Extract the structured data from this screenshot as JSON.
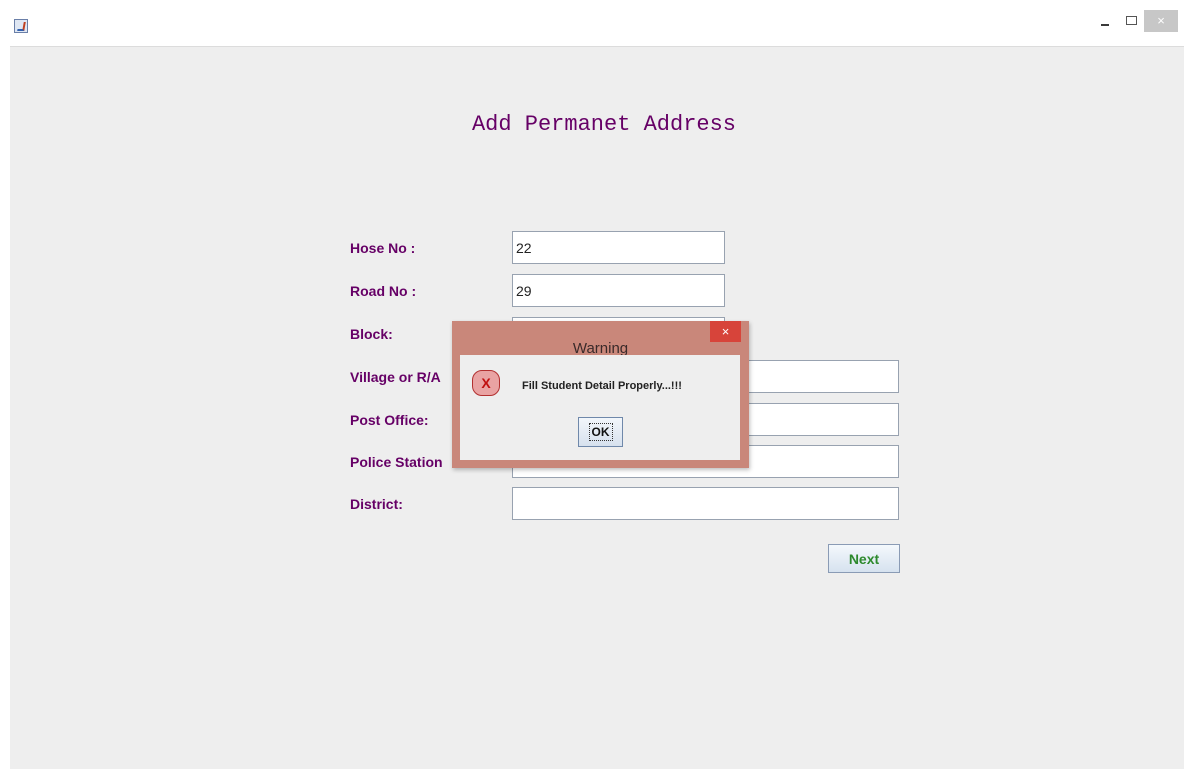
{
  "window": {
    "title": "",
    "app_icon": "java-cup-icon",
    "close_glyph": "×",
    "colors": {
      "background": "#eeeeee",
      "accent": "#660066",
      "next_text": "#2d8a2d"
    }
  },
  "form": {
    "heading": "Add Permanet Address",
    "fields": [
      {
        "label": "Hose No :",
        "value": "22"
      },
      {
        "label": "Road No :",
        "value": "29"
      },
      {
        "label": "Block:",
        "value": ""
      },
      {
        "label": "Village or R/A",
        "value": ""
      },
      {
        "label": "Post Office:",
        "value": ""
      },
      {
        "label": "Police Station",
        "value": ""
      },
      {
        "label": "District:",
        "value": ""
      }
    ],
    "next_label": "Next"
  },
  "dialog": {
    "title": "Warning",
    "close_glyph": "×",
    "icon": "error-icon",
    "icon_glyph": "X",
    "message": "Fill Student Detail Properly...!!!",
    "ok_label": "OK",
    "colors": {
      "frame": "#c9877a",
      "close": "#d7443a"
    }
  }
}
